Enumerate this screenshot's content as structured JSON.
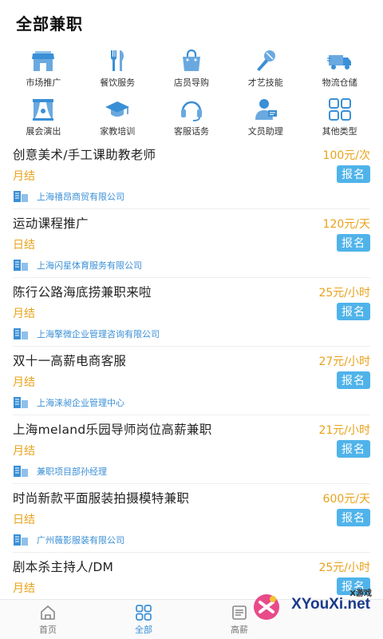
{
  "header": {
    "title": "全部兼职"
  },
  "categories": [
    {
      "label": "市场推广",
      "icon": "store-icon",
      "color": "#3a8fd6"
    },
    {
      "label": "餐饮服务",
      "icon": "fork-knife-icon",
      "color": "#3a8fd6"
    },
    {
      "label": "店员导购",
      "icon": "shopping-bag-icon",
      "color": "#3a8fd6"
    },
    {
      "label": "才艺技能",
      "icon": "microphone-icon",
      "color": "#3a8fd6"
    },
    {
      "label": "物流仓储",
      "icon": "truck-icon",
      "color": "#3a8fd6"
    },
    {
      "label": "展会演出",
      "icon": "stage-curtain-icon",
      "color": "#3a8fd6"
    },
    {
      "label": "家教培训",
      "icon": "graduation-cap-icon",
      "color": "#3a8fd6"
    },
    {
      "label": "客服话务",
      "icon": "headset-icon",
      "color": "#3a8fd6"
    },
    {
      "label": "文员助理",
      "icon": "clerk-icon",
      "color": "#3a8fd6"
    },
    {
      "label": "其他类型",
      "icon": "grid-icon",
      "color": "#3a8fd6"
    }
  ],
  "jobs": [
    {
      "title": "创意美术/手工课助教老师",
      "pay": "100元/次",
      "cycle": "月结",
      "apply": "报名",
      "company": "上海禧昂商贸有限公司"
    },
    {
      "title": "运动课程推广",
      "pay": "120元/天",
      "cycle": "日结",
      "apply": "报名",
      "company": "上海闪星体育服务有限公司"
    },
    {
      "title": "陈行公路海底捞兼职来啦",
      "pay": "25元/小时",
      "cycle": "月结",
      "apply": "报名",
      "company": "上海擎微企业管理咨询有限公司"
    },
    {
      "title": "双十一高薪电商客服",
      "pay": "27元/小时",
      "cycle": "月结",
      "apply": "报名",
      "company": "上海涞昶企业管理中心"
    },
    {
      "title": "上海meland乐园导师岗位高薪兼职",
      "pay": "21元/小时",
      "cycle": "月结",
      "apply": "报名",
      "company": "兼职项目部孙经理"
    },
    {
      "title": "时尚新款平面服装拍摄模特兼职",
      "pay": "600元/天",
      "cycle": "日结",
      "apply": "报名",
      "company": "广州薇影服装有限公司"
    },
    {
      "title": "剧本杀主持人/DM",
      "pay": "25元/小时",
      "cycle": "月结",
      "apply": "报名",
      "company": ""
    }
  ],
  "tabbar": {
    "tabs": [
      {
        "label": "首页",
        "icon": "home-icon",
        "active": false
      },
      {
        "label": "全部",
        "icon": "grid-icon",
        "active": true
      },
      {
        "label": "高薪",
        "icon": "document-icon",
        "active": false
      }
    ]
  },
  "watermark": {
    "small": "X游戏",
    "big": "XYouXi.net"
  },
  "colors": {
    "accent": "#3a8fd6",
    "pay": "#e8a21a",
    "apply_button": "#4fb3ea"
  }
}
